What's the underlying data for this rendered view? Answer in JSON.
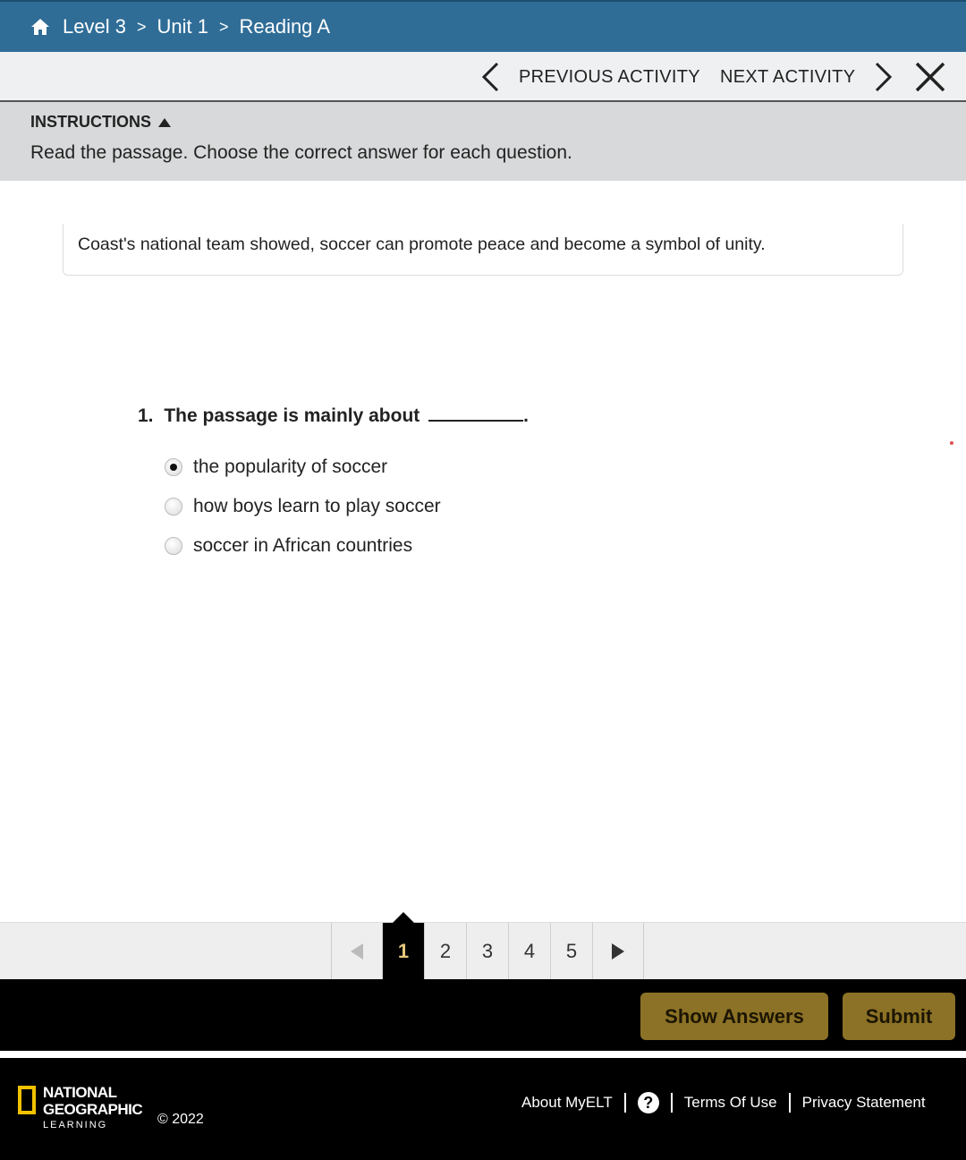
{
  "breadcrumb": {
    "level": "Level 3",
    "unit": "Unit 1",
    "lesson": "Reading A",
    "separator": ">"
  },
  "nav": {
    "previous_label": "PREVIOUS ACTIVITY",
    "next_label": "NEXT ACTIVITY"
  },
  "instructions": {
    "heading": "INSTRUCTIONS",
    "text": "Read the passage. Choose the correct answer for each question."
  },
  "passage": {
    "visible_text": "Coast's national team showed, soccer can promote peace and become a symbol of unity."
  },
  "question": {
    "number": "1.",
    "text": "The passage is mainly about",
    "end_punct": ".",
    "options": [
      {
        "label": "the popularity of soccer",
        "selected": true
      },
      {
        "label": "how boys learn to play soccer",
        "selected": false
      },
      {
        "label": "soccer in African countries",
        "selected": false
      }
    ]
  },
  "pager": {
    "pages": [
      "1",
      "2",
      "3",
      "4",
      "5"
    ],
    "current": "1"
  },
  "actions": {
    "show_answers": "Show Answers",
    "submit": "Submit"
  },
  "footer": {
    "logo_line1": "NATIONAL",
    "logo_line2": "GEOGRAPHIC",
    "logo_line3": "LEARNING",
    "copyright": "© 2022",
    "about": "About MyELT",
    "help": "?",
    "terms": "Terms Of Use",
    "privacy": "Privacy Statement"
  },
  "colors": {
    "topbar": "#2f6d97",
    "button_gold": "#8c7226",
    "active_page_text": "#e6c77a",
    "logo_yellow": "#f2c200"
  }
}
